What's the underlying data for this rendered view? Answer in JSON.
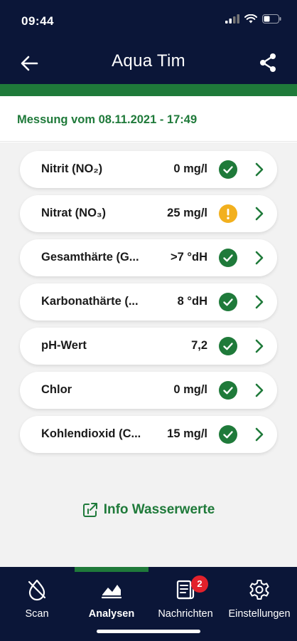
{
  "status_bar": {
    "time": "09:44"
  },
  "header": {
    "title": "Aqua Tim",
    "back_icon": "arrow-left-icon",
    "share_icon": "share-icon"
  },
  "measurement": {
    "label": "Messung vom 08.11.2021 - 17:49"
  },
  "rows": [
    {
      "label": "Nitrit (NO₂)",
      "value": "0 mg/l",
      "status": "ok"
    },
    {
      "label": "Nitrat (NO₃)",
      "value": "25 mg/l",
      "status": "warn"
    },
    {
      "label": "Gesamthärte (G...",
      "value": ">7 °dH",
      "status": "ok"
    },
    {
      "label": "Karbonathärte (...",
      "value": "8 °dH",
      "status": "ok"
    },
    {
      "label": "pH-Wert",
      "value": "7,2",
      "status": "ok"
    },
    {
      "label": "Chlor",
      "value": "0 mg/l",
      "status": "ok"
    },
    {
      "label": "Kohlendioxid (C...",
      "value": "15 mg/l",
      "status": "ok"
    }
  ],
  "info_link": {
    "label": "Info Wasserwerte"
  },
  "tabs": [
    {
      "label": "Scan",
      "icon": "drop-icon",
      "active": false
    },
    {
      "label": "Analysen",
      "icon": "chart-icon",
      "active": true
    },
    {
      "label": "Nachrichten",
      "icon": "news-icon",
      "active": false,
      "badge": "2"
    },
    {
      "label": "Einstellungen",
      "icon": "gear-icon",
      "active": false
    }
  ],
  "colors": {
    "navy": "#0b1638",
    "green": "#1f7a3a",
    "warning": "#f2b01e",
    "badge": "#e3212b"
  }
}
